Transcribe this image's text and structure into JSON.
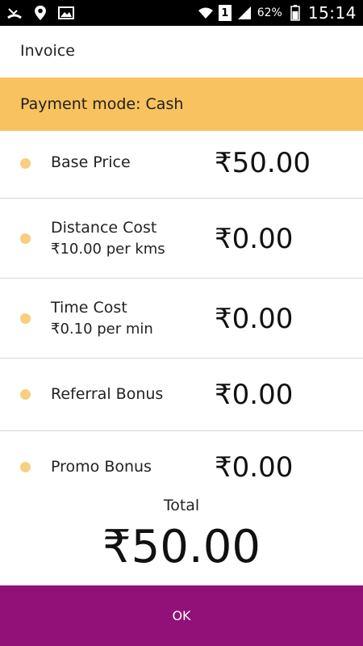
{
  "status_bar": {
    "icons": [
      "missed-call-icon",
      "location-pin-icon",
      "image-icon",
      "wifi-icon",
      "sim-1-icon",
      "signal-icon",
      "battery-icon"
    ],
    "sim_label": "1",
    "battery": "62%",
    "time": "15:14"
  },
  "header": {
    "title": "Invoice"
  },
  "payment": {
    "text": "Payment mode: Cash"
  },
  "items": [
    {
      "label": "Base Price",
      "sub": "",
      "amount": "₹50.00"
    },
    {
      "label": "Distance Cost",
      "sub": "₹10.00 per kms",
      "amount": "₹0.00"
    },
    {
      "label": "Time Cost",
      "sub": "₹0.10 per min",
      "amount": "₹0.00"
    },
    {
      "label": "Referral Bonus",
      "sub": "",
      "amount": "₹0.00"
    },
    {
      "label": "Promo Bonus",
      "sub": "",
      "amount": "₹0.00"
    }
  ],
  "total": {
    "label": "Total",
    "amount": "₹50.00"
  },
  "ok_button": {
    "label": "OK"
  },
  "colors": {
    "payment_bar": "#f8c25e",
    "dot": "#f8cf80",
    "ok_button": "#911179",
    "status_bar": "#000000"
  }
}
